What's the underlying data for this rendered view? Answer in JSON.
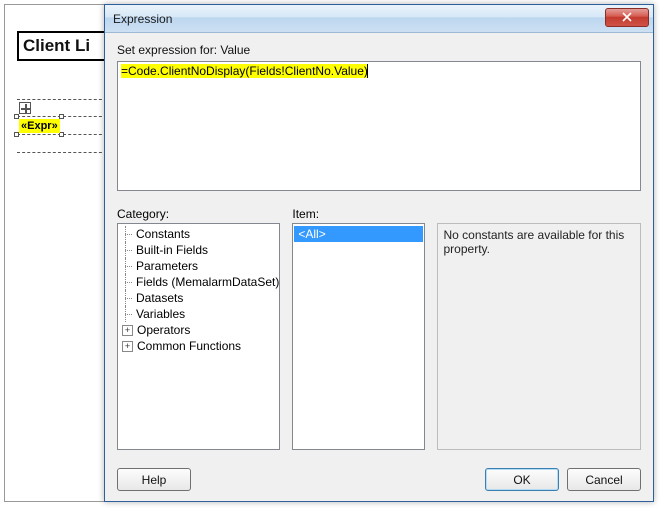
{
  "designer": {
    "title_cell": "Client Li",
    "expr_placeholder": "«Expr»"
  },
  "dialog": {
    "title": "Expression",
    "set_expression_label": "Set expression for: Value",
    "expression_value": "=Code.ClientNoDisplay(Fields!ClientNo.Value)",
    "category_label": "Category:",
    "item_label": "Item:",
    "description_text": "No constants are available for this property.",
    "tree": {
      "constants": "Constants",
      "builtin": "Built-in Fields",
      "parameters": "Parameters",
      "fields": "Fields (MemalarmDataSet)",
      "datasets": "Datasets",
      "variables": "Variables",
      "operators": "Operators",
      "common_functions": "Common Functions"
    },
    "item_list": {
      "all": "<All>"
    },
    "buttons": {
      "help": "Help",
      "ok": "OK",
      "cancel": "Cancel"
    }
  }
}
